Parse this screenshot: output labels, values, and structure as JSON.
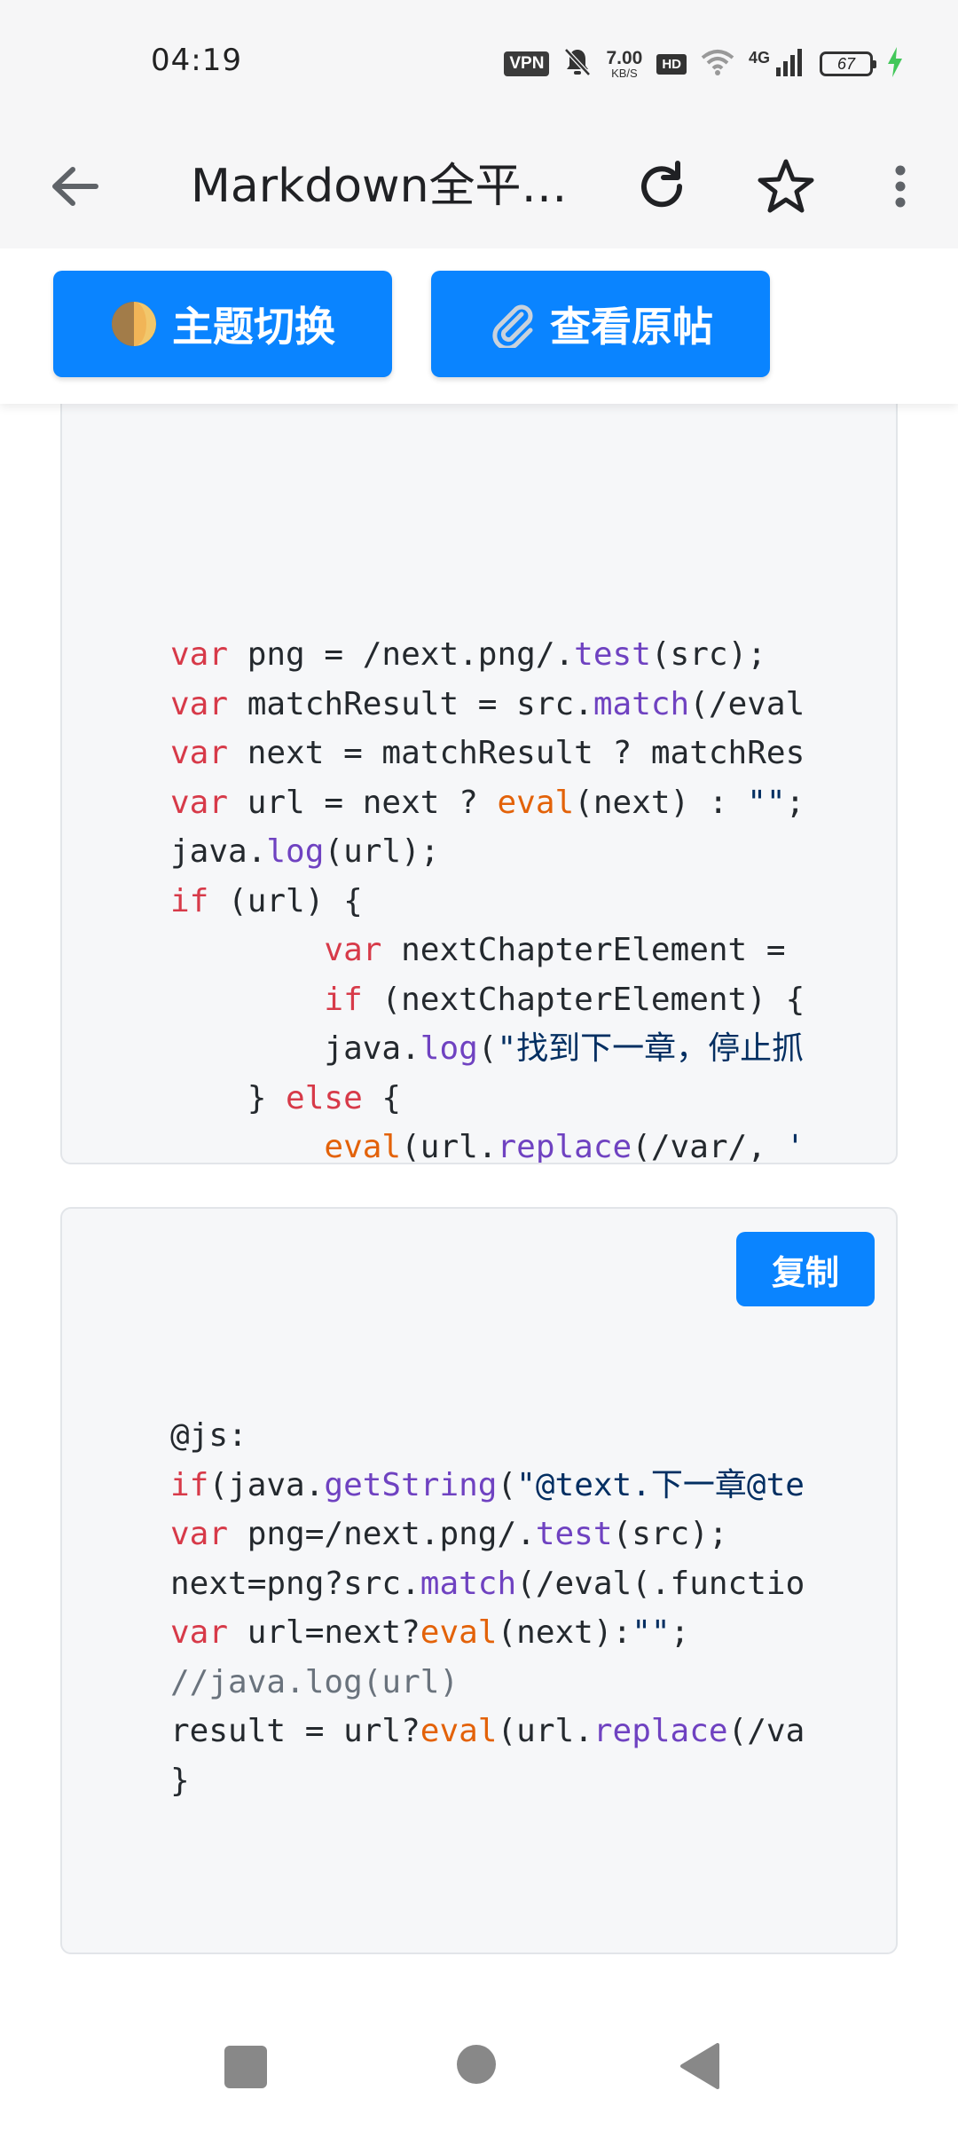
{
  "status_bar": {
    "time": "04:19",
    "vpn": "VPN",
    "speed_value": "7.00",
    "speed_unit": "KB/S",
    "hd": "HD",
    "network": "4G",
    "battery": "67",
    "icons": [
      "vpn-icon",
      "mute-bell-icon",
      "hd-icon",
      "wifi-icon",
      "signal-icon",
      "battery-icon",
      "charging-bolt-icon"
    ],
    "charging_color": "#43c75a"
  },
  "app_bar": {
    "title": "Markdown全平…",
    "icons": [
      "back-arrow-icon",
      "reload-icon",
      "star-icon",
      "more-vert-icon"
    ]
  },
  "actions": {
    "theme_label": "主题切换",
    "source_label": "查看原帖",
    "accent_color": "#0a84ff"
  },
  "code_blocks": [
    {
      "lines": [
        "var png = /next.png/.test(src);",
        "var matchResult = src.match(/eval",
        "var next = matchResult ? matchRes",
        "var url = next ? eval(next) : \"\";",
        "java.log(url);",
        "if (url) {",
        "        var nextChapterElement = ",
        "        if (nextChapterElement) {",
        "        java.log(\"找到下一章，停止抓",
        "    } else {",
        "        eval(url.replace(/var/, '",
        "    }",
        "}"
      ]
    },
    {
      "copy_label": "复制",
      "lines": [
        "@js:",
        "if(java.getString(\"@text.下一章@te",
        "var png=/next.png/.test(src);",
        "next=png?src.match(/eval(.functio",
        "var url=next?eval(next):\"\";",
        "//java.log(url)",
        "result = url?eval(url.replace(/va",
        "}"
      ]
    }
  ],
  "nav_bar": {
    "icons": [
      "recent-apps-icon",
      "home-icon",
      "back-triangle-icon"
    ]
  }
}
